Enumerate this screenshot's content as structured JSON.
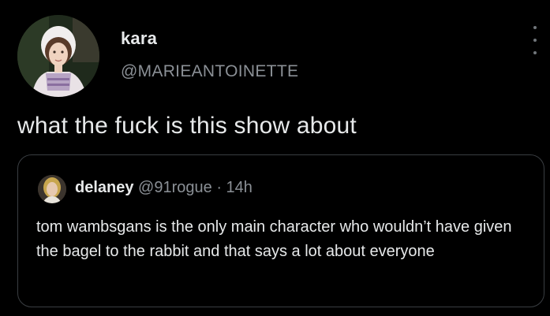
{
  "tweet": {
    "author": {
      "display_name": "kara",
      "handle": "@MARIEANTOINETTE",
      "avatar_icon": "profile-photo-girl-bonnet"
    },
    "menu_icon": "more-vertical-icon",
    "text": "what the fuck is this show about"
  },
  "quote": {
    "author": {
      "display_name": "delaney",
      "handle": "@91rogue",
      "avatar_icon": "profile-photo-small"
    },
    "separator": "·",
    "time": "14h",
    "text": "tom wambsgans is the only main character who wouldn’t have given the bagel to the rabbit and that says a lot about everyone"
  },
  "colors": {
    "background": "#000000",
    "primary_text": "#e7e9ea",
    "secondary_text": "#8b9096",
    "card_border": "#3a3e42"
  }
}
